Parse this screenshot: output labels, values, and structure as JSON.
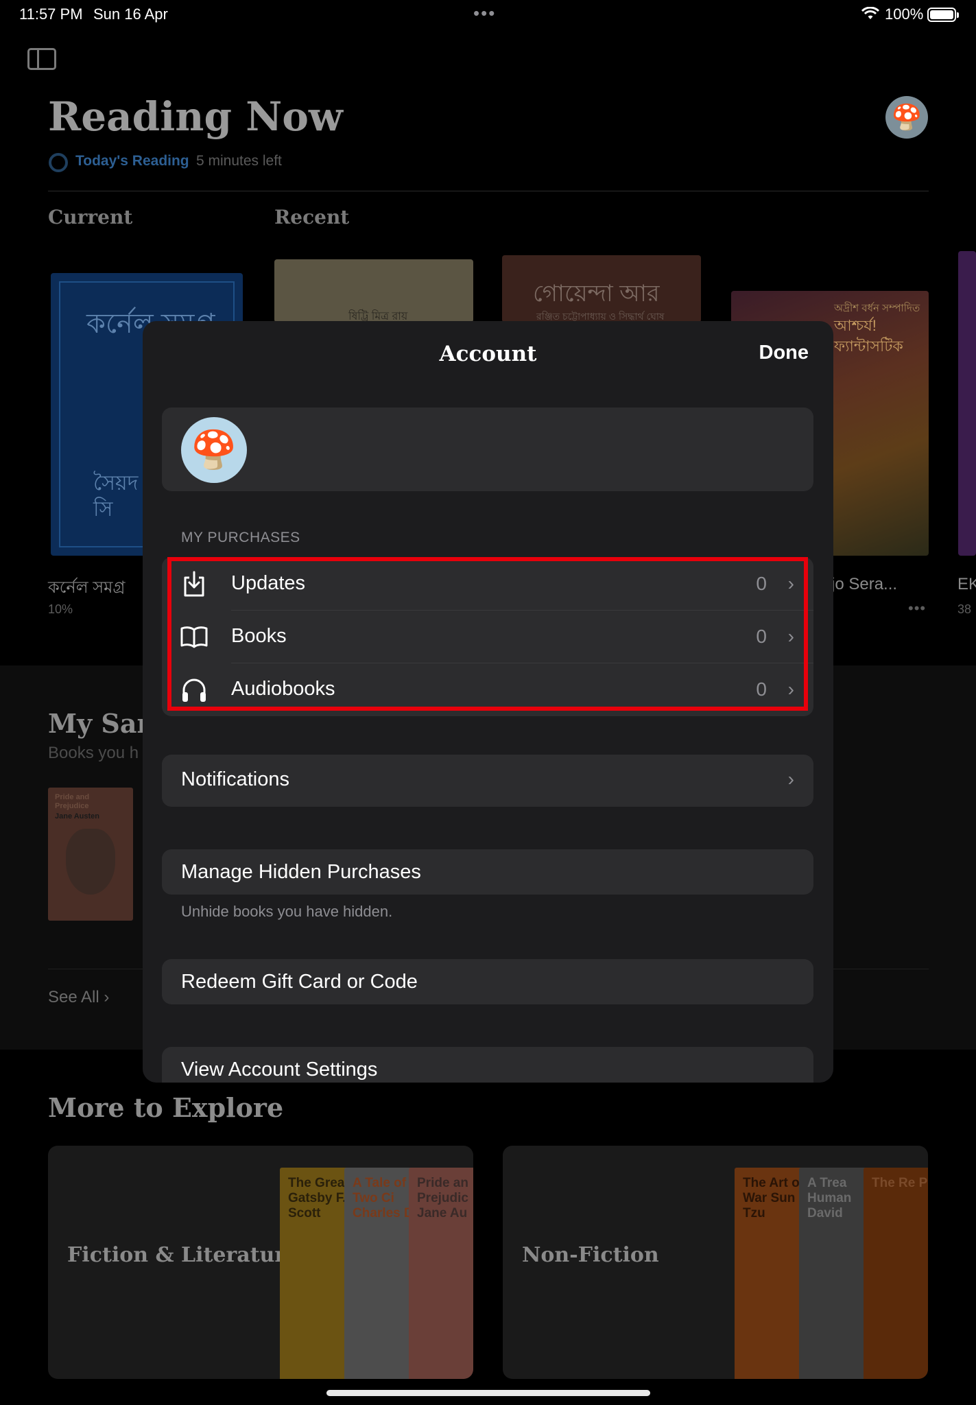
{
  "status_bar": {
    "time": "11:57 PM",
    "date": "Sun 16 Apr",
    "battery": "100%"
  },
  "background": {
    "title": "Reading Now",
    "todays_reading": "Today's Reading",
    "minutes_left": "5 minutes left",
    "section_current": "Current",
    "section_recent": "Recent",
    "book1": {
      "cover_title": "কর্নেল সমগ্র",
      "cover_author": "সৈয়দ\nসি",
      "label": "কর্নেল সমগ্র",
      "progress": "10%"
    },
    "book2": {
      "cover_text": "ষিট্রি মিত্র রায়"
    },
    "book3": {
      "cover_title": "গোয়েন্দা আর গোয়েন্দা",
      "cover_sub": "রঞ্জিত চট্টোপাধ্যায় ও সিদ্ধার্থ ঘোষ"
    },
    "book4": {
      "cover_top": "অদ্রীশ বর্ধন সম্পাদিত",
      "cover_title": "আশ্চর্য!\nফ্যান্টাসটিক",
      "label": "jo Sera...",
      "more": "•••"
    },
    "book5": {
      "label": "EK",
      "progress": "38"
    },
    "samples_title": "My Sam",
    "samples_sub": "Books you h",
    "sample_cover": {
      "title": "Pride and\nPrejudice",
      "author": "Jane Austen"
    },
    "see_all": "See All",
    "explore_title": "More to Explore",
    "explore_cards": [
      {
        "label": "Fiction & Literature",
        "books": [
          "The Great Gatsby F. Scott",
          "A Tale of Two Ci Charles D",
          "Pride an Prejudic Jane Au"
        ]
      },
      {
        "label": "Non-Fiction",
        "books": [
          "The Art of War Sun Tzu",
          "A Trea Human David",
          "The Re Pl"
        ]
      }
    ]
  },
  "modal": {
    "title": "Account",
    "done_label": "Done",
    "avatar_icon": "mushroom-icon",
    "purchases_header": "MY PURCHASES",
    "purchases": [
      {
        "icon": "download-tray-icon",
        "label": "Updates",
        "count": "0"
      },
      {
        "icon": "book-icon",
        "label": "Books",
        "count": "0"
      },
      {
        "icon": "headphones-icon",
        "label": "Audiobooks",
        "count": "0"
      }
    ],
    "notifications_label": "Notifications",
    "manage_hidden_label": "Manage Hidden Purchases",
    "manage_hidden_footnote": "Unhide books you have hidden.",
    "redeem_label": "Redeem Gift Card or Code",
    "view_settings_label": "View Account Settings",
    "highlight_color": "#e8000b"
  }
}
